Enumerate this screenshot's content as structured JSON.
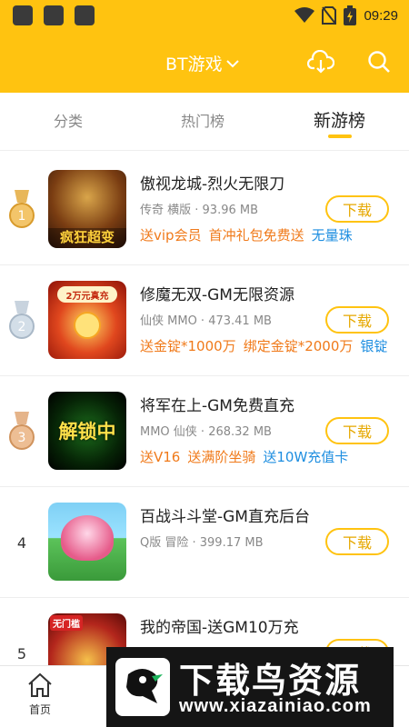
{
  "status_bar": {
    "time": "09:29"
  },
  "header": {
    "title": "BT游戏"
  },
  "tabs": [
    {
      "label": "分类"
    },
    {
      "label": "热门榜"
    },
    {
      "label": "新游榜"
    }
  ],
  "colors": {
    "accent": "#FFC310",
    "tag_orange": "#F07A1A",
    "tag_blue": "#1E8EE0"
  },
  "games": [
    {
      "rank": "1",
      "name": "傲视龙城-烈火无限刀",
      "meta": "传奇 横版 · 93.96 MB",
      "tags": [
        "送vip会员",
        "首冲礼包免费送",
        "无量珠"
      ],
      "thumb_text": "疯狂超变",
      "download_label": "下载"
    },
    {
      "rank": "2",
      "name": "修魔无双-GM无限资源",
      "meta": "仙侠 MMO · 473.41 MB",
      "tags": [
        "送金锭*1000万",
        "绑定金锭*2000万",
        "银锭"
      ],
      "thumb_text": "2万元真充",
      "download_label": "下载"
    },
    {
      "rank": "3",
      "name": "将军在上-GM免费直充",
      "meta": "MMO 仙侠 · 268.32 MB",
      "tags": [
        "送V16",
        "送满阶坐骑",
        "送10W充值卡"
      ],
      "thumb_text": "解锁中",
      "download_label": "下载"
    },
    {
      "rank": "4",
      "name": "百战斗斗堂-GM直充后台",
      "meta": "Q版 冒险 · 399.17 MB",
      "tags": [],
      "thumb_text": "",
      "download_label": "下载"
    },
    {
      "rank": "5",
      "name": "我的帝国-送GM10万充",
      "meta": "",
      "tags": [],
      "thumb_text": "无门槛",
      "download_label": "下载"
    }
  ],
  "bottom_nav": [
    {
      "label": "首页"
    }
  ],
  "watermark": {
    "big": "下载鸟资源",
    "small": "www.xiazainiao.com"
  }
}
